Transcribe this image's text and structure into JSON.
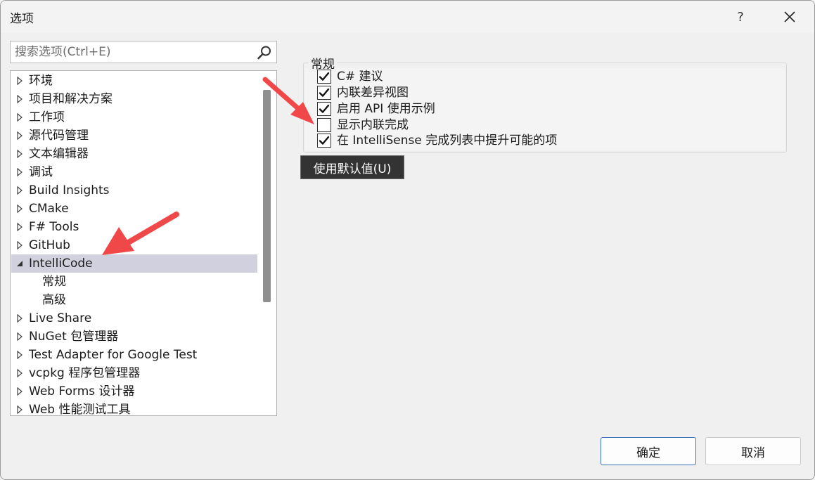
{
  "window": {
    "title": "选项",
    "help_label": "?",
    "close_label": "✕"
  },
  "search": {
    "placeholder": "搜索选项(Ctrl+E)"
  },
  "tree": {
    "items": [
      {
        "label": "环境",
        "expanded": false
      },
      {
        "label": "项目和解决方案",
        "expanded": false
      },
      {
        "label": "工作项",
        "expanded": false
      },
      {
        "label": "源代码管理",
        "expanded": false
      },
      {
        "label": "文本编辑器",
        "expanded": false
      },
      {
        "label": "调试",
        "expanded": false
      },
      {
        "label": "Build Insights",
        "expanded": false
      },
      {
        "label": "CMake",
        "expanded": false
      },
      {
        "label": "F# Tools",
        "expanded": false
      },
      {
        "label": "GitHub",
        "expanded": false
      },
      {
        "label": "IntelliCode",
        "expanded": true,
        "selected": true
      },
      {
        "label": "常规",
        "child": true
      },
      {
        "label": "高级",
        "child": true
      },
      {
        "label": "Live Share",
        "expanded": false
      },
      {
        "label": "NuGet 包管理器",
        "expanded": false
      },
      {
        "label": "Test Adapter for Google Test",
        "expanded": false
      },
      {
        "label": "vcpkg 程序包管理器",
        "expanded": false
      },
      {
        "label": "Web Forms 设计器",
        "expanded": false
      },
      {
        "label": "Web 性能测试工具",
        "expanded": false
      }
    ]
  },
  "general": {
    "group_title": "常规",
    "options": [
      {
        "label": "C# 建议",
        "checked": true
      },
      {
        "label": "内联差异视图",
        "checked": true
      },
      {
        "label": "启用 API 使用示例",
        "checked": true
      },
      {
        "label": "显示内联完成",
        "checked": false
      },
      {
        "label": "在 IntelliSense 完成列表中提升可能的项",
        "checked": true
      }
    ],
    "default_button": "使用默认值(U)"
  },
  "footer": {
    "ok_label": "确定",
    "cancel_label": "取消"
  },
  "colors": {
    "annotation_arrow": "#f04848",
    "selection": "#d0d0de",
    "ok_border": "#3b72b9"
  }
}
